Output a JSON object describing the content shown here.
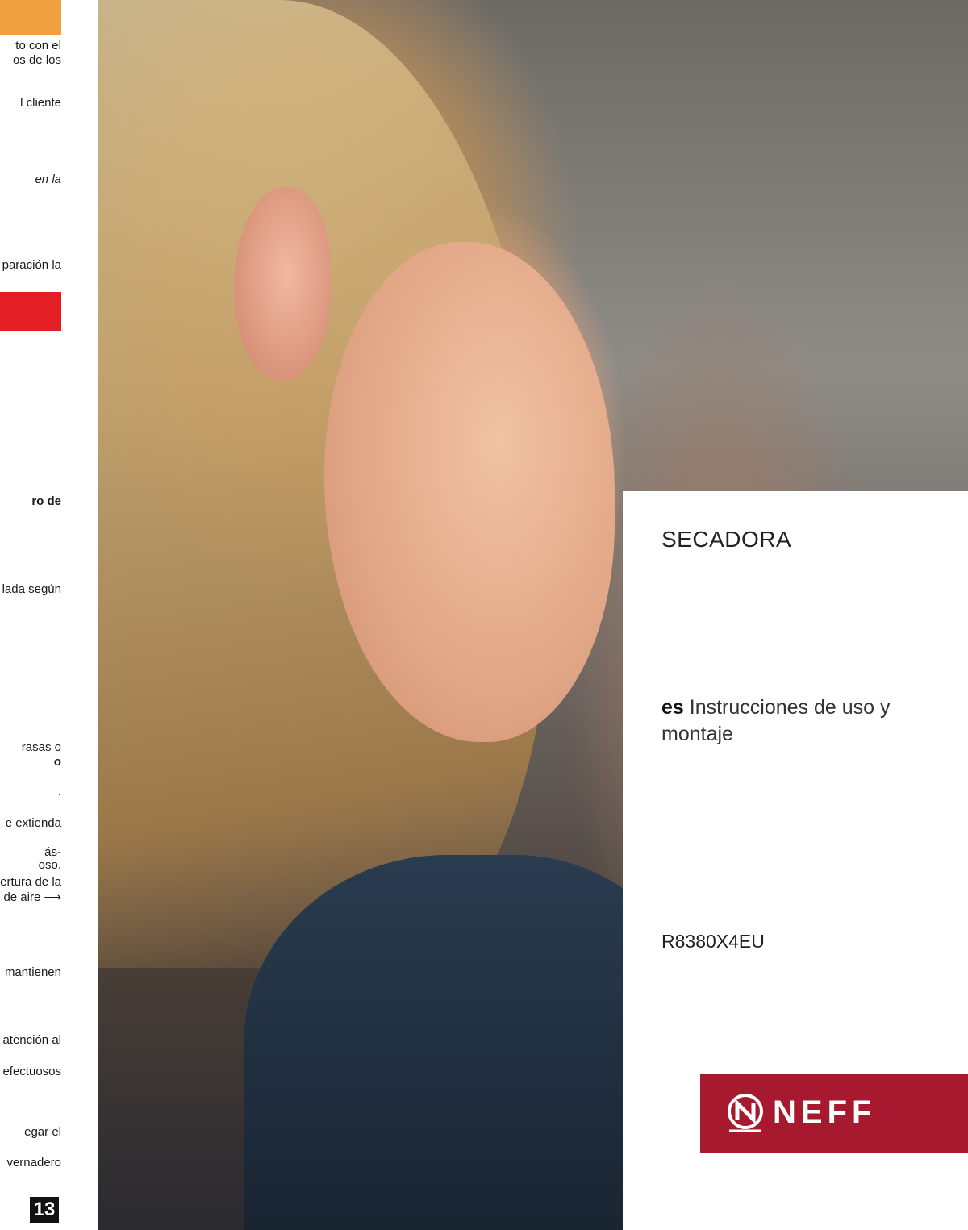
{
  "left_page": {
    "lines": [
      {
        "text": "to con el",
        "style": "normal"
      },
      {
        "text": "os de los",
        "style": "normal"
      },
      {
        "text": "l cliente",
        "style": "normal"
      },
      {
        "text": "en la",
        "style": "italic"
      },
      {
        "text": "paración la",
        "style": "normal"
      },
      {
        "text": "ro de",
        "style": "bold"
      },
      {
        "text": "lada según",
        "style": "normal"
      },
      {
        "text": "rasas o",
        "style": "normal"
      },
      {
        "text": "o",
        "style": "bold"
      },
      {
        "text": ".",
        "style": "normal"
      },
      {
        "text": "e extienda",
        "style": "normal"
      },
      {
        "text": "ás-",
        "style": "normal"
      },
      {
        "text": "oso.",
        "style": "normal"
      },
      {
        "text": "ertura de la",
        "style": "normal"
      },
      {
        "text": "de aire ⟶",
        "style": "normal"
      },
      {
        "text": "mantienen",
        "style": "normal"
      },
      {
        "text": "atención al",
        "style": "normal"
      },
      {
        "text": "efectuosos",
        "style": "normal"
      },
      {
        "text": "egar el",
        "style": "normal"
      },
      {
        "text": "vernadero",
        "style": "normal"
      }
    ],
    "page_number": "13"
  },
  "cover": {
    "title": "SECADORA",
    "language_code": "es",
    "subtitle": "Instrucciones de uso y montaje",
    "model": "R8380X4EU",
    "brand": "NEFF",
    "brand_color": "#a6192e"
  },
  "colors": {
    "orange": "#f0a040",
    "red": "#e31e24"
  }
}
